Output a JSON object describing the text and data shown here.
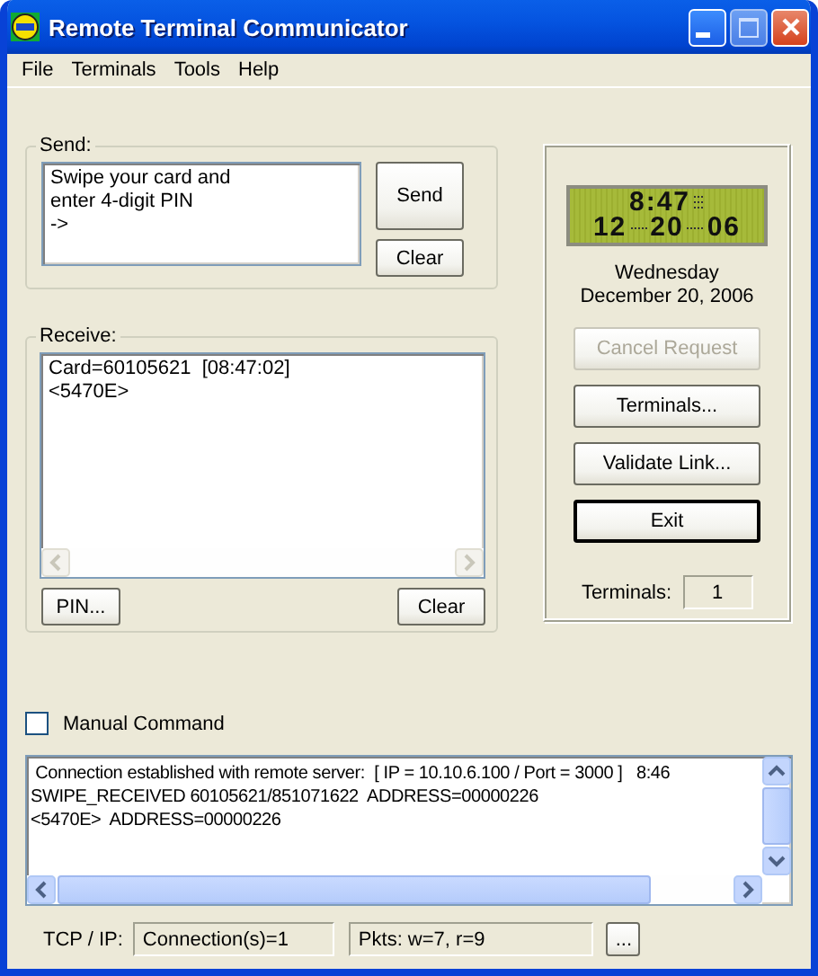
{
  "window": {
    "title": "Remote Terminal Communicator"
  },
  "menu": [
    "File",
    "Terminals",
    "Tools",
    "Help"
  ],
  "send": {
    "label": "Send:",
    "value": [
      "Swipe your card and",
      "enter 4-digit PIN",
      "->"
    ],
    "buttons": [
      "Send",
      "Clear"
    ]
  },
  "receive": {
    "label": "Receive:",
    "lines": [
      "Card=60105621  [08:47:02]",
      "<5470E>"
    ],
    "buttons": [
      "PIN...",
      "Clear"
    ]
  },
  "clock": {
    "time": "8:47",
    "date": [
      "12",
      "20",
      "06"
    ],
    "weekday": "Wednesday",
    "date_text": "December 20, 2006"
  },
  "actions": [
    {
      "label": "Cancel Request",
      "disabled": true,
      "default": false
    },
    {
      "label": "Terminals...",
      "disabled": false,
      "default": false
    },
    {
      "label": "Validate Link...",
      "disabled": false,
      "default": false
    },
    {
      "label": "Exit",
      "disabled": false,
      "default": true
    }
  ],
  "terminals": {
    "label": "Terminals:",
    "value": "1"
  },
  "manual_command": {
    "label": "Manual Command",
    "checked": false
  },
  "log": {
    "lines": [
      " Connection established with remote server:  [ IP = 10.10.6.100 / Port = 3000 ]   8:46",
      "SWIPE_RECEIVED 60105621/851071622  ADDRESS=00000226",
      "<5470E>  ADDRESS=00000226"
    ]
  },
  "status_bar": {
    "label": "TCP / IP:",
    "connections": "Connection(s)=1",
    "packets": "Pkts: w=7, r=9",
    "button": "..."
  }
}
